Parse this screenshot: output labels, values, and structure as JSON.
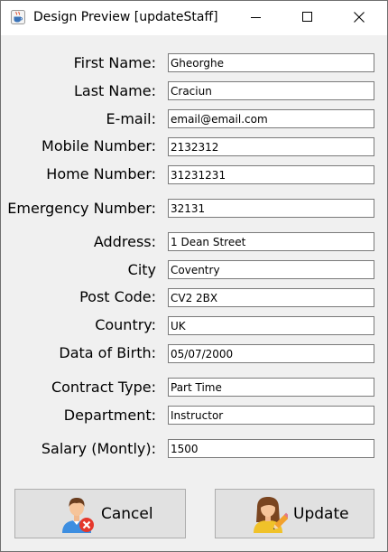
{
  "window": {
    "title": "Design Preview [updateStaff]",
    "app_icon": "java-cup-icon",
    "controls": [
      "minimize-icon",
      "maximize-icon",
      "close-icon"
    ]
  },
  "form": {
    "first_name": {
      "label": "First Name:",
      "value": "Gheorghe"
    },
    "last_name": {
      "label": "Last Name:",
      "value": "Craciun"
    },
    "email": {
      "label": "E-mail:",
      "value": "email@email.com"
    },
    "mobile": {
      "label": "Mobile Number:",
      "value": "2132312"
    },
    "home": {
      "label": "Home Number:",
      "value": "31231231"
    },
    "emergency": {
      "label": "Emergency Number:",
      "value": "32131"
    },
    "address": {
      "label": "Address:",
      "value": "1 Dean Street"
    },
    "city": {
      "label": "City",
      "value": "Coventry"
    },
    "post_code": {
      "label": "Post Code:",
      "value": "CV2 2BX"
    },
    "country": {
      "label": "Country:",
      "value": "UK"
    },
    "dob": {
      "label": "Data of Birth:",
      "value": "05/07/2000"
    },
    "contract": {
      "label": "Contract Type:",
      "value": "Part Time"
    },
    "department": {
      "label": "Department:",
      "value": "Instructor"
    },
    "salary": {
      "label": "Salary (Montly):",
      "value": "1500"
    }
  },
  "buttons": {
    "cancel": {
      "label": "Cancel",
      "icon": "user-remove-icon"
    },
    "update": {
      "label": "Update",
      "icon": "user-edit-icon"
    }
  }
}
